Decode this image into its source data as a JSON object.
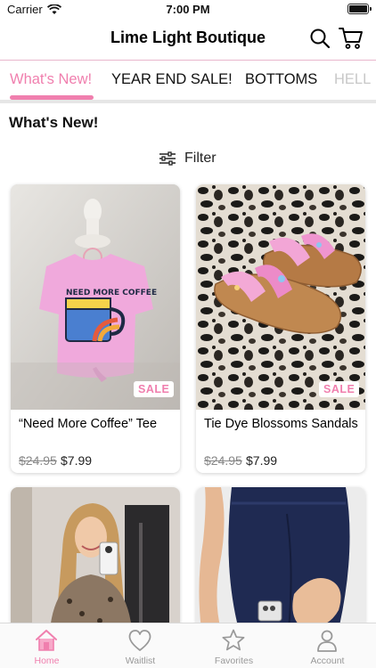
{
  "status_bar": {
    "carrier": "Carrier",
    "time": "7:00 PM"
  },
  "header": {
    "title": "Lime Light Boutique",
    "search_icon": "search-icon",
    "cart_icon": "cart-icon"
  },
  "tabs": [
    {
      "label": "What's New!",
      "active": true
    },
    {
      "label": "YEAR END SALE!",
      "active": false
    },
    {
      "label": "BOTTOMS",
      "active": false
    },
    {
      "label": "HELL",
      "active": false
    }
  ],
  "section": {
    "title": "What's New!"
  },
  "filter": {
    "label": "Filter",
    "icon": "sliders-icon"
  },
  "products": [
    {
      "name": "“Need More Coffee” Tee",
      "old_price": "$24.95",
      "price": "$7.99",
      "badge": "SALE",
      "shirt_text": "NEED MORE COFFEE"
    },
    {
      "name": "Tie Dye Blossoms Sandals",
      "old_price": "$24.95",
      "price": "$7.99",
      "badge": "SALE"
    }
  ],
  "tabbar": [
    {
      "label": "Home",
      "icon": "home-icon",
      "active": true
    },
    {
      "label": "Waitlist",
      "icon": "heart-icon",
      "active": false
    },
    {
      "label": "Favorites",
      "icon": "star-icon",
      "active": false
    },
    {
      "label": "Account",
      "icon": "person-icon",
      "active": false
    }
  ],
  "colors": {
    "accent": "#f07fae",
    "tab_divider": "#e9b7cc",
    "muted": "#999999"
  }
}
